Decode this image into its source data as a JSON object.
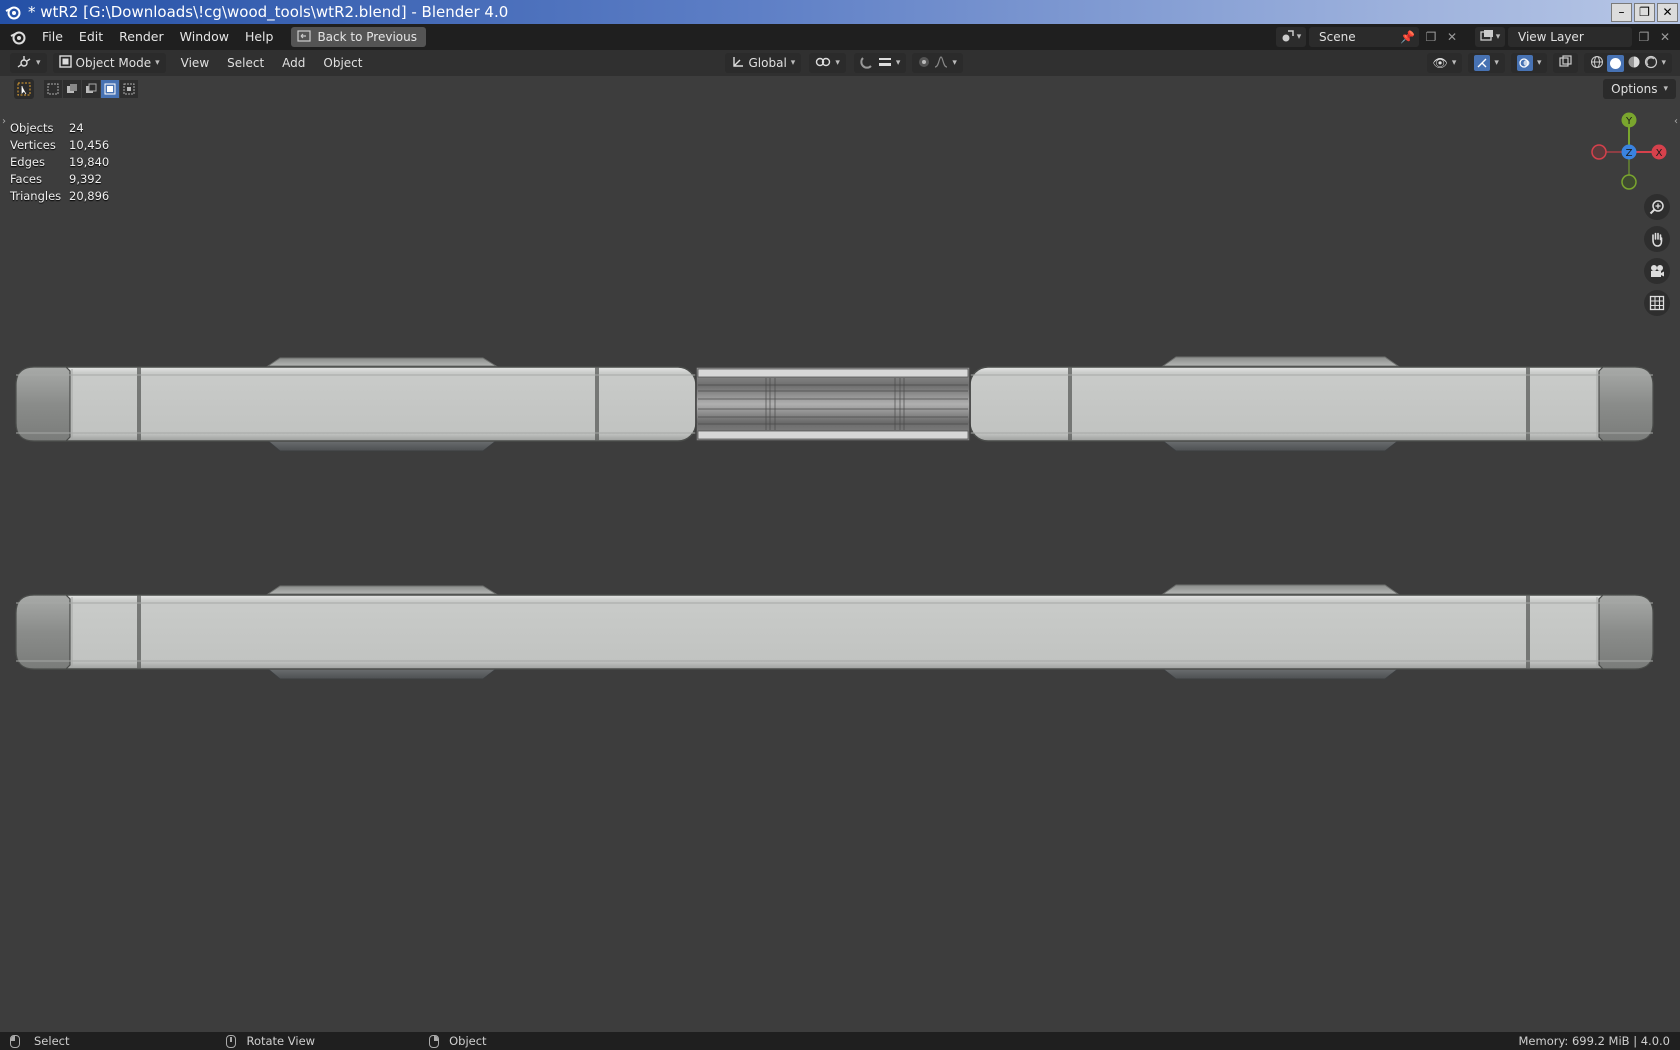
{
  "window": {
    "title": "* wtR2 [G:\\Downloads\\!cg\\wood_tools\\wtR2.blend] - Blender 4.0",
    "buttons": [
      "minimize-icon",
      "restore-icon",
      "close-icon"
    ]
  },
  "menubar": {
    "items": [
      "File",
      "Edit",
      "Render",
      "Window",
      "Help"
    ],
    "back_button": "Back to Previous",
    "scene_label": "Scene",
    "view_layer_label": "View Layer"
  },
  "viewport_header": {
    "mode": "Object Mode",
    "menus": [
      "View",
      "Select",
      "Add",
      "Object"
    ],
    "transform_orientation": "Global"
  },
  "toolbar": {
    "options_label": "Options",
    "active_select_mode": 3
  },
  "stats": [
    {
      "label": "Objects",
      "value": "24"
    },
    {
      "label": "Vertices",
      "value": "10,456"
    },
    {
      "label": "Edges",
      "value": "19,840"
    },
    {
      "label": "Faces",
      "value": "9,392"
    },
    {
      "label": "Triangles",
      "value": "20,896"
    }
  ],
  "gizmo": {
    "axes": [
      "Y",
      "Z",
      "X"
    ],
    "colors": {
      "x": "#d6414c",
      "y": "#7aa62e",
      "z": "#3a83e0"
    }
  },
  "nav_tools": [
    "zoom-icon",
    "pan-hand-icon",
    "camera-icon",
    "grid-ortho-icon"
  ],
  "statusbar": {
    "items": [
      {
        "mouse": "left",
        "label": "Select"
      },
      {
        "mouse": "middle",
        "label": "Rotate View"
      },
      {
        "mouse": "right",
        "label": "Object"
      }
    ],
    "right_text": "Memory: 699.2 MiB | 4.0.0"
  },
  "colors": {
    "viewport_bg": "#3d3d3d",
    "header_bg": "#303030",
    "topbar_bg": "#1f1f1f",
    "accent": "#4772b3",
    "mesh_light": "#c4c6c4",
    "mesh_dark": "#8a8a8a"
  }
}
